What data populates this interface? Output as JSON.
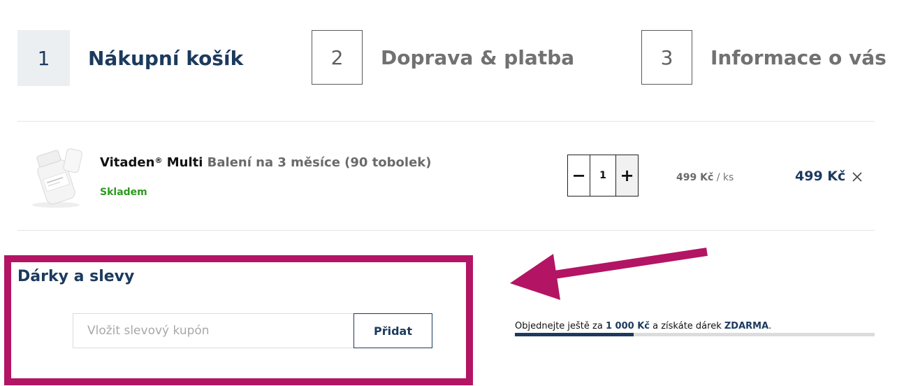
{
  "steps": [
    {
      "number": "1",
      "label": "Nákupní košík",
      "active": true
    },
    {
      "number": "2",
      "label": "Doprava & platba",
      "active": false
    },
    {
      "number": "3",
      "label": "Informace o vás",
      "active": false
    }
  ],
  "cart_item": {
    "name": "Vitaden",
    "reg_mark": "®",
    "name_suffix": " Multi",
    "variant": " Balení na 3 měsíce (90 tobolek)",
    "stock": "Skladem",
    "quantity": "1",
    "minus_label": "−",
    "plus_label": "+",
    "unit_price": "499 Kč",
    "unit_suffix": " / ks",
    "total_price": "499 Kč"
  },
  "discounts": {
    "title": "Dárky a slevy",
    "coupon_placeholder": "Vložit slevový kupón",
    "add_button": "Přidat"
  },
  "free_gift": {
    "text_before": "Objednejte ještě za ",
    "amount": "1 000 Kč",
    "text_middle": " a získáte dárek ",
    "free_label": "ZDARMA",
    "text_after": ".",
    "progress": 0.33
  },
  "colors": {
    "primary": "#1c3a5e",
    "highlight": "#b31464",
    "stock_green": "#2d9a1e"
  }
}
